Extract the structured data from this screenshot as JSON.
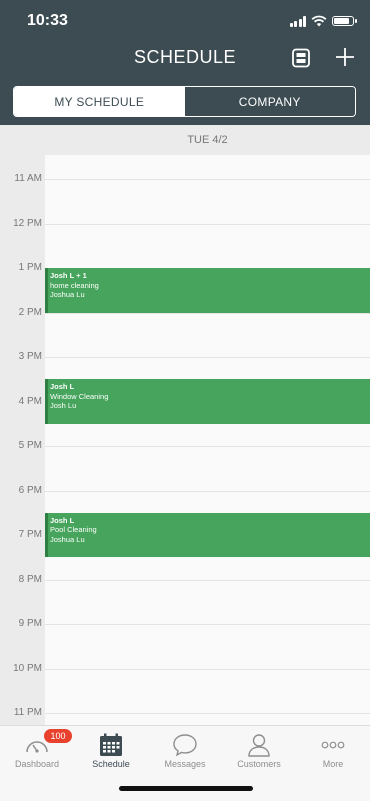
{
  "status_bar": {
    "time": "10:33"
  },
  "header": {
    "title": "SCHEDULE"
  },
  "tabs": {
    "my_schedule": "MY SCHEDULE",
    "company": "COMPANY"
  },
  "day": {
    "label": "TUE 4/2"
  },
  "hours": [
    "11 AM",
    "12 PM",
    "1 PM",
    "2 PM",
    "3 PM",
    "4 PM",
    "5 PM",
    "6 PM",
    "7 PM",
    "8 PM",
    "9 PM",
    "10 PM",
    "11 PM"
  ],
  "events": [
    {
      "title": "Josh L + 1",
      "service": "home cleaning",
      "assignee": "Joshua Lu",
      "start": "1 PM",
      "end": "2 PM"
    },
    {
      "title": "Josh L",
      "service": "Window Cleaning",
      "assignee": "Josh Lu",
      "start": "3:30 PM",
      "end": "4:30 PM"
    },
    {
      "title": "Josh L",
      "service": "Pool Cleaning",
      "assignee": "Joshua Lu",
      "start": "6:30 PM",
      "end": "7:30 PM"
    }
  ],
  "tabbar": {
    "dashboard": "Dashboard",
    "dashboard_badge": "100",
    "schedule": "Schedule",
    "messages": "Messages",
    "customers": "Customers",
    "more": "More"
  },
  "colors": {
    "header": "#3d4c53",
    "event": "#46a45c",
    "badge": "#e8412e"
  }
}
